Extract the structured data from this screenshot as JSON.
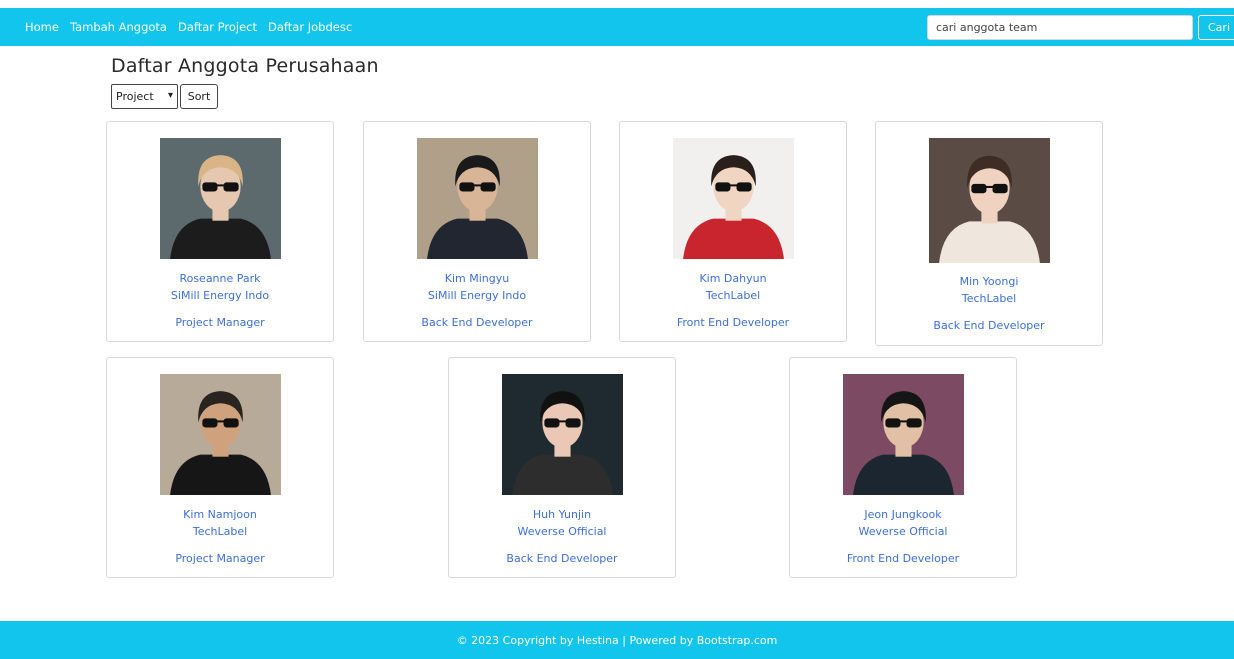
{
  "nav": {
    "links": [
      "Home",
      "Tambah Anggota",
      "Daftar Project",
      "Daftar Jobdesc"
    ],
    "search_value": "cari anggota team",
    "search_button": "Cari"
  },
  "main": {
    "title": "Daftar Anggota Perusahaan",
    "sort_select_value": "Project",
    "sort_button": "Sort"
  },
  "members": [
    {
      "name": "Roseanne Park",
      "company": "SiMill Energy Indo",
      "role": "Project Manager",
      "bg": "#5d6a6d",
      "skin": "#e6c8b0",
      "hair": "#d9b487",
      "cloth": "#1c1c1c"
    },
    {
      "name": "Kim Mingyu",
      "company": "SiMill Energy Indo",
      "role": "Back End Developer",
      "bg": "#b0a089",
      "skin": "#d9b598",
      "hair": "#1a1a1a",
      "cloth": "#222631"
    },
    {
      "name": "Kim Dahyun",
      "company": "TechLabel",
      "role": "Front End Developer",
      "bg": "#f1f0ee",
      "skin": "#f0d5c3",
      "hair": "#2a1f1a",
      "cloth": "#c9252e"
    },
    {
      "name": "Min Yoongi",
      "company": "TechLabel",
      "role": "Back End Developer",
      "bg": "#5a4b44",
      "skin": "#efd3c0",
      "hair": "#3d2d25",
      "cloth": "#efe6de"
    },
    {
      "name": "Kim Namjoon",
      "company": "TechLabel",
      "role": "Project Manager",
      "bg": "#b7aa99",
      "skin": "#cfa27d",
      "hair": "#2a2420",
      "cloth": "#161616"
    },
    {
      "name": "Huh Yunjin",
      "company": "Weverse Official",
      "role": "Back End Developer",
      "bg": "#1f2a30",
      "skin": "#eac8b5",
      "hair": "#111111",
      "cloth": "#2d2d2d"
    },
    {
      "name": "Jeon Jungkook",
      "company": "Weverse Official",
      "role": "Front End Developer",
      "bg": "#7c4b63",
      "skin": "#e2c0a6",
      "hair": "#151515",
      "cloth": "#1c2630"
    }
  ],
  "footer": {
    "text": "© 2023 Copyright by Hestina  |  Powered by Bootstrap.com"
  }
}
